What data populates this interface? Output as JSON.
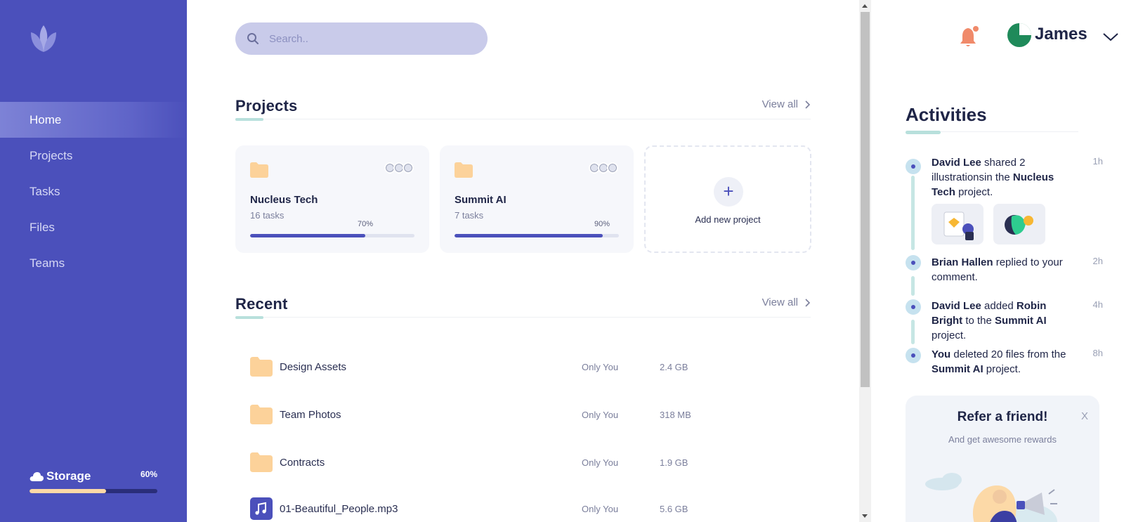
{
  "sidebar": {
    "nav": [
      "Home",
      "Projects",
      "Tasks",
      "Files",
      "Teams"
    ],
    "active": "Home",
    "storage": {
      "label": "Storage",
      "percent_label": "60%",
      "percent": 60
    }
  },
  "search": {
    "placeholder": "Search.."
  },
  "projects": {
    "title": "Projects",
    "view_all": "View all",
    "cards": [
      {
        "name": "Nucleus Tech",
        "tasks": "16 tasks",
        "progress_label": "70%",
        "progress": 70
      },
      {
        "name": "Summit AI",
        "tasks": "7 tasks",
        "progress_label": "90%",
        "progress": 90
      }
    ],
    "add_label": "Add new project"
  },
  "recent": {
    "title": "Recent",
    "view_all": "View all",
    "files": [
      {
        "name": "Design Assets",
        "access": "Only You",
        "size": "2.4 GB",
        "icon": "folder-icon"
      },
      {
        "name": "Team Photos",
        "access": "Only You",
        "size": "318 MB",
        "icon": "folder-icon"
      },
      {
        "name": "Contracts",
        "access": "Only You",
        "size": "1.9 GB",
        "icon": "folder-icon"
      },
      {
        "name": "01-Beautiful_People.mp3",
        "access": "Only You",
        "size": "5.6 GB",
        "icon": "music-icon"
      }
    ]
  },
  "user": {
    "name": "James"
  },
  "activities": {
    "title": "Activities",
    "items": [
      {
        "time": "1h",
        "parts": [
          [
            "David Lee",
            true
          ],
          [
            " shared 2 illustrationsin the ",
            false
          ],
          [
            "Nucleus Tech",
            true
          ],
          [
            " project.",
            false
          ]
        ]
      },
      {
        "time": "2h",
        "parts": [
          [
            "Brian Hallen",
            true
          ],
          [
            " replied to your comment.",
            false
          ]
        ]
      },
      {
        "time": "4h",
        "parts": [
          [
            "David Lee",
            true
          ],
          [
            " added ",
            false
          ],
          [
            "Robin Bright",
            true
          ],
          [
            " to the ",
            false
          ],
          [
            "Summit AI",
            true
          ],
          [
            " project.",
            false
          ]
        ]
      },
      {
        "time": "8h",
        "parts": [
          [
            "You",
            true
          ],
          [
            " deleted 20 files from the ",
            false
          ],
          [
            "Summit AI",
            true
          ],
          [
            " project.",
            false
          ]
        ]
      }
    ]
  },
  "refer": {
    "title": "Refer a friend!",
    "subtitle": "And get awesome rewards",
    "close": "X"
  },
  "colors": {
    "sidebar": "#4b50bb",
    "accent": "#4b50bb",
    "folder": "#fcd29a",
    "bell": "#f08a6a",
    "avatar": "#1f8a5a"
  }
}
